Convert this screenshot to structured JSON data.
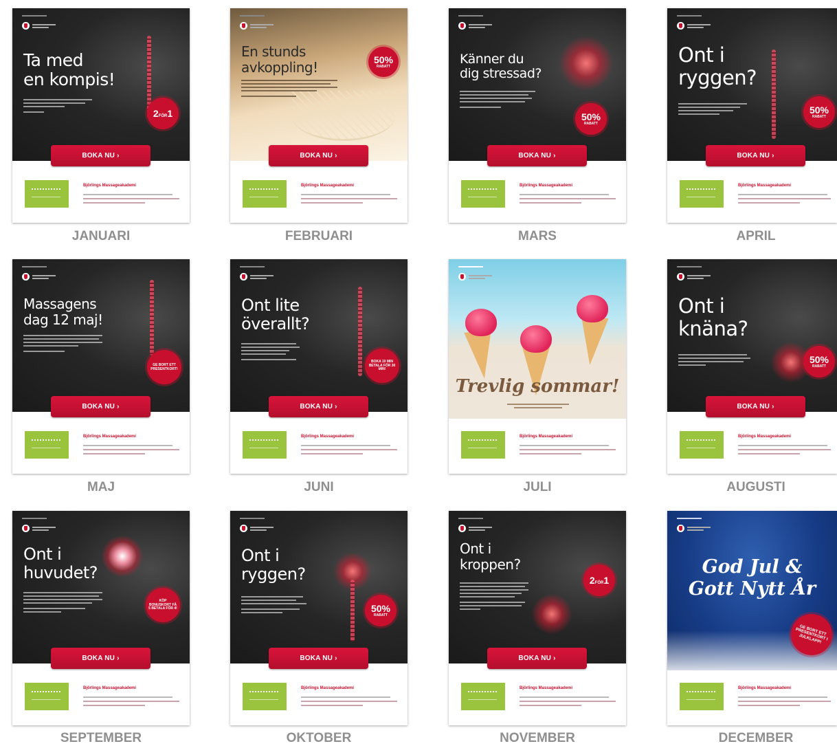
{
  "cta_label": "BOKA NU ›",
  "footer_name": "Björlings Massageakademi",
  "badges": {
    "two_for_one_big": "2",
    "two_for_one_mid": "FÖR",
    "two_for_one_end": "1",
    "percent": "50%",
    "rabatt": "RABATT",
    "maj_gift": "GE BORT ETT PRESENTKORT!",
    "juni_text": "BOKA 10 MIN BETALA FÖR 30 MIN!",
    "sept_text": "KÖP BONUSKORT FÅ 5 BETALA FÖR 4!",
    "dec_text": "GE BORT ETT PRESENTKORT I JULKLAPP!"
  },
  "cards": [
    {
      "month": "JANUARI",
      "headline": "Ta med\nen kompis!"
    },
    {
      "month": "FEBRUARI",
      "headline": "En stunds\navkoppling!"
    },
    {
      "month": "MARS",
      "headline": "Känner du\ndig stressad?"
    },
    {
      "month": "APRIL",
      "headline": "Ont i\nryggen?"
    },
    {
      "month": "MAJ",
      "headline": "Massagens\ndag 12 maj!"
    },
    {
      "month": "JUNI",
      "headline": "Ont lite\növerallt?"
    },
    {
      "month": "JULI",
      "headline": "Trevlig sommar!"
    },
    {
      "month": "AUGUSTI",
      "headline": "Ont i\nknäna?"
    },
    {
      "month": "SEPTEMBER",
      "headline": "Ont i\nhuvudet?"
    },
    {
      "month": "OKTOBER",
      "headline": "Ont i\nryggen?"
    },
    {
      "month": "NOVEMBER",
      "headline": "Ont i\nkroppen?"
    },
    {
      "month": "DECEMBER",
      "headline": "God Jul &\nGott Nytt År"
    }
  ]
}
